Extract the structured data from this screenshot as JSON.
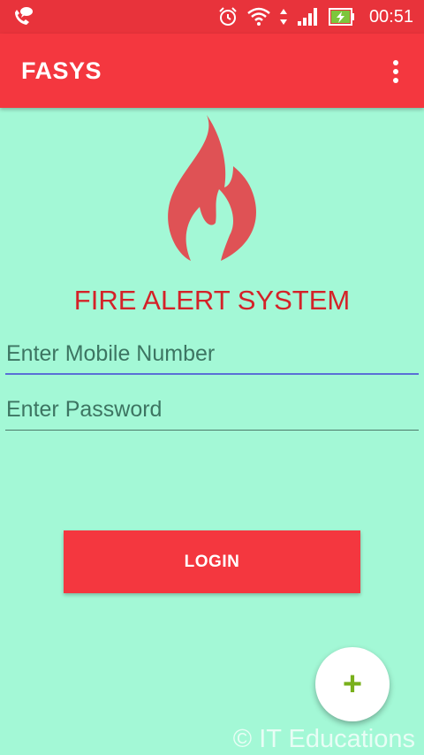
{
  "status_bar": {
    "time": "00:51"
  },
  "app_bar": {
    "title": "FASYS"
  },
  "login": {
    "headline": "FIRE ALERT SYSTEM",
    "mobile_placeholder": "Enter Mobile Number",
    "password_placeholder": "Enter Password",
    "login_label": "LOGIN"
  },
  "fab": {
    "label": "+"
  },
  "watermark": "© IT Educations",
  "colors": {
    "background": "#a3f8d6",
    "primary": "#f4373f",
    "status_bar": "#e8333b",
    "headline": "#d42228",
    "flame": "#df5255",
    "fab_icon": "#79b01b"
  },
  "icons": {
    "status_left": "phone-message-icon",
    "alarm": "alarm-clock-icon",
    "wifi": "wifi-icon",
    "data": "data-transfer-icon",
    "signal": "signal-icon",
    "battery": "battery-charging-icon",
    "menu": "overflow-menu-icon",
    "logo": "flame-icon"
  }
}
